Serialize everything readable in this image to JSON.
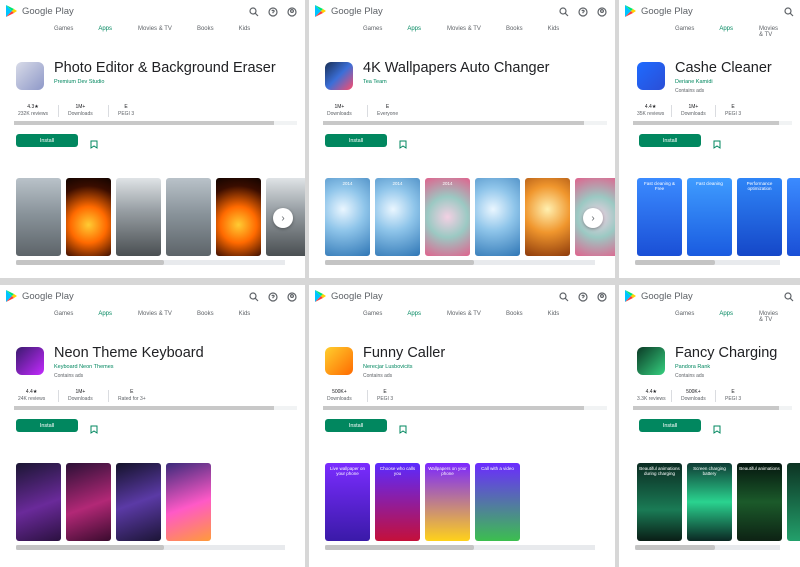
{
  "brand": {
    "name": "Google Play"
  },
  "nav_labels": [
    "Games",
    "Apps",
    "Movies & TV",
    "Books",
    "Kids"
  ],
  "colors": {
    "accent": "#01875f",
    "divider": "#d7d7d7"
  },
  "panels": [
    {
      "title": "Photo Editor & Background Eraser",
      "developer": "Premium Dev Studio",
      "stats": [
        {
          "value": "4.3★",
          "label": "232K reviews"
        },
        {
          "value": "1M+",
          "label": "Downloads"
        },
        {
          "value": "E",
          "label": "PEGI 3"
        }
      ],
      "install_label": "Install",
      "icon": "photo-editor-icon",
      "shots": [
        "city-cutout",
        "fire",
        "street",
        "city-cutout",
        "fire",
        "street"
      ],
      "show_next": true
    },
    {
      "title": "4K Wallpapers Auto Changer",
      "developer": "Tea Team",
      "stats": [
        {
          "value": "1M+",
          "label": "Downloads"
        },
        {
          "value": "E",
          "label": "Everyone"
        }
      ],
      "install_label": "Install",
      "icon": "wallpaper-icon",
      "shots": [
        "ice-blue",
        "ice-blue",
        "crystal-pink",
        "ice-blue",
        "ice-orange",
        "crystal-pink"
      ],
      "shot_texts": [
        "2014",
        "2014",
        "2014"
      ],
      "show_next": true
    },
    {
      "title": "Cashe Cleaner",
      "developer": "Deriane Kamidi",
      "sub": "Contains ads",
      "stats": [
        {
          "value": "4.4★",
          "label": "35K reviews"
        },
        {
          "value": "1M+",
          "label": "Downloads"
        },
        {
          "value": "E",
          "label": "PEGI 3"
        }
      ],
      "install_label": "Install",
      "icon": "cleaner-icon",
      "shots": [
        "cleaner-1",
        "cleaner-2",
        "cleaner-3",
        "cleaner-1"
      ],
      "shot_texts": [
        "Fast cleaning & Free",
        "Fast cleaning",
        "Performance optimization"
      ],
      "show_next": false
    },
    {
      "title": "Neon Theme Keyboard",
      "developer": "Keyboard Neon Themes",
      "sub": "Contains ads",
      "stats": [
        {
          "value": "4.4★",
          "label": "24K reviews"
        },
        {
          "value": "1M+",
          "label": "Downloads"
        },
        {
          "value": "E",
          "label": "Rated for 3+"
        }
      ],
      "install_label": "Install",
      "icon": "neon-keyboard-icon",
      "shots": [
        "keyboard-1",
        "keyboard-2",
        "keyboard-3",
        "keyboard-4"
      ],
      "show_next": false
    },
    {
      "title": "Funny Caller",
      "developer": "Nerecjar Lusbovicits",
      "sub": "Contains ads",
      "stats": [
        {
          "value": "500K+",
          "label": "Downloads"
        },
        {
          "value": "E",
          "label": "PEGI 3"
        }
      ],
      "install_label": "Install",
      "icon": "funny-caller-icon",
      "shots": [
        "caller-mouse",
        "caller-iron",
        "caller-boxer",
        "caller-craft"
      ],
      "shot_texts": [
        "Live wallpaper on your phone",
        "Choose who calls you",
        "Wallpapers on your phone",
        "Call with a video"
      ],
      "show_next": false
    },
    {
      "title": "Fancy Charging",
      "developer": "Pandora Rank",
      "sub": "Contains ads",
      "stats": [
        {
          "value": "4.4★",
          "label": "3.3K reviews"
        },
        {
          "value": "500K+",
          "label": "Downloads"
        },
        {
          "value": "E",
          "label": "PEGI 3"
        }
      ],
      "install_label": "Install",
      "icon": "charging-icon",
      "shots": [
        "charge-1",
        "charge-2",
        "charge-3",
        "charge-4"
      ],
      "shot_texts": [
        "Beautiful animations during charging",
        "Screen charging battery",
        "Beautiful animations"
      ],
      "show_next": false
    }
  ]
}
